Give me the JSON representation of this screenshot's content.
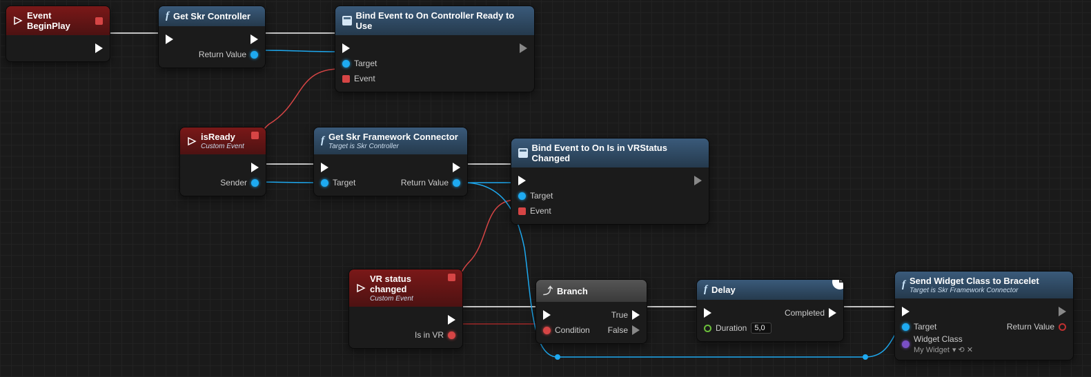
{
  "nodes": {
    "beginplay": {
      "title": "Event BeginPlay"
    },
    "getctrl": {
      "title": "Get Skr Controller",
      "out": "Return Value"
    },
    "bind1": {
      "title": "Bind Event to On Controller Ready to Use",
      "target": "Target",
      "event": "Event"
    },
    "isready": {
      "title": "isReady",
      "sub": "Custom Event",
      "sender": "Sender"
    },
    "getfw": {
      "title": "Get Skr Framework Connector",
      "sub": "Target is Skr Controller",
      "tgt": "Target",
      "out": "Return Value"
    },
    "bind2": {
      "title": "Bind Event to On Is in VRStatus Changed",
      "target": "Target",
      "event": "Event"
    },
    "vrstat": {
      "title": "VR status changed",
      "sub": "Custom Event",
      "isvr": "Is in VR"
    },
    "branch": {
      "title": "Branch",
      "cond": "Condition",
      "t": "True",
      "f": "False"
    },
    "delay": {
      "title": "Delay",
      "dur": "Duration",
      "durval": "5,0",
      "comp": "Completed"
    },
    "send": {
      "title": "Send Widget Class to Bracelet",
      "sub": "Target is Skr Framework Connector",
      "tgt": "Target",
      "wc": "Widget Class",
      "wsel": "My Widget",
      "rv": "Return Value"
    }
  }
}
